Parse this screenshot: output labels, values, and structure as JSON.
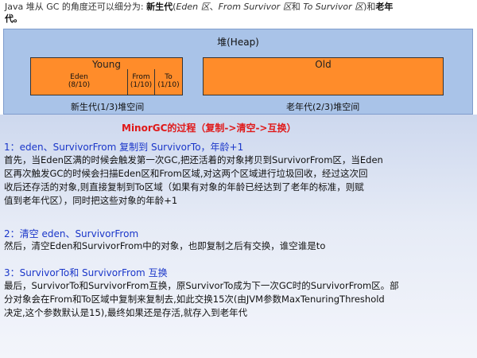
{
  "intro": {
    "prefix": "Java 堆从 GC 的角度还可以细分为: ",
    "new_gen": "新生代",
    "eden": "Eden 区",
    "sep1": "、",
    "from": "From Survivor 区",
    "and": "和",
    "to": "To Survivor 区",
    "tail": ")和",
    "old_gen": "老年",
    "line2": "代。"
  },
  "heap": {
    "title": "堆(Heap)",
    "young_label": "Young",
    "old_label": "Old",
    "eden_name": "Eden",
    "eden_ratio": "(8/10)",
    "from_name": "From",
    "from_ratio": "(1/10)",
    "to_name": "To",
    "to_ratio": "(1/10)",
    "young_caption": "新生代(1/3)堆空间",
    "old_caption": "老年代(2/3)堆空间"
  },
  "minor_title": "MinorGC的过程（复制->清空->互换）",
  "steps": {
    "s1_title": "1：eden、SurvivorFrom 复制到 SurvivorTo，年龄+1",
    "s1_l1": "首先，当Eden区满的时候会触发第一次GC,把还活着的对象拷贝到SurvivorFrom区，当Eden",
    "s1_l2": "区再次触发GC的时候会扫描Eden区和From区域,对这两个区域进行垃圾回收，经过这次回",
    "s1_l3": "收后还存活的对象,则直接复制到To区域（如果有对象的年龄已经达到了老年的标准，则赋",
    "s1_l4": "值到老年代区），同时把这些对象的年龄+1",
    "s2_title": "2：清空 eden、SurvivorFrom",
    "s2_l1": "然后，清空Eden和SurvivorFrom中的对象，也即复制之后有交换，谁空谁是to",
    "s3_title": "3：SurvivorTo和 SurvivorFrom 互换",
    "s3_l1": "最后，SurvivorTo和SurvivorFrom互换，原SurvivorTo成为下一次GC时的SurvivorFrom区。部",
    "s3_l2": "分对象会在From和To区域中复制来复制去,如此交换15次(由JVM参数MaxTenuringThreshold",
    "s3_l3": "决定,这个参数默认是15),最终如果还是存活,就存入到老年代"
  }
}
